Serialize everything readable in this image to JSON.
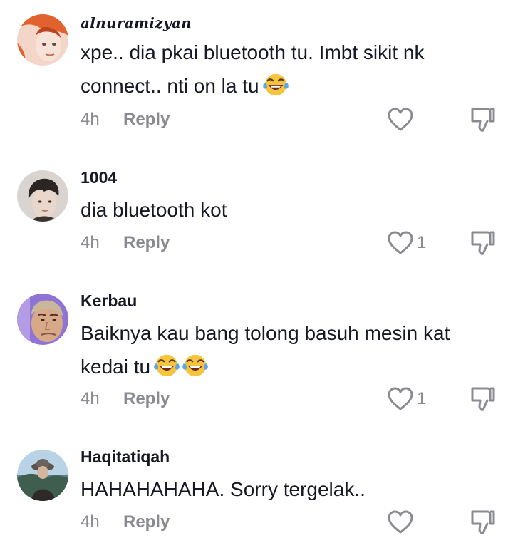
{
  "comments": [
    {
      "username": "alnuramizyan",
      "text": "xpe.. dia pkai bluetooth tu. Imbt sikit nk connect.. nti on la tu",
      "emoji": [
        "face-with-tears-of-joy"
      ],
      "time": "4h",
      "reply_label": "Reply",
      "likes": "",
      "avatar_icon": "avatar-woman-orange"
    },
    {
      "username": "1004",
      "text": "dia bluetooth kot",
      "emoji": [],
      "time": "4h",
      "reply_label": "Reply",
      "likes": "1",
      "avatar_icon": "avatar-man-dark-hair"
    },
    {
      "username": "Kerbau",
      "text": "Baiknya kau bang tolong basuh mesin kat kedai tu",
      "emoji": [
        "face-with-tears-of-joy",
        "face-with-tears-of-joy"
      ],
      "time": "4h",
      "reply_label": "Reply",
      "likes": "1",
      "avatar_icon": "avatar-man-short-hair"
    },
    {
      "username": "Haqitatiqah",
      "text": "HAHAHAHAHA. Sorry tergelak..",
      "emoji": [],
      "time": "4h",
      "reply_label": "Reply",
      "likes": "",
      "avatar_icon": "avatar-person-hat-outdoor"
    }
  ],
  "colors": {
    "text": "#161823",
    "secondary": "#8a8b91"
  }
}
